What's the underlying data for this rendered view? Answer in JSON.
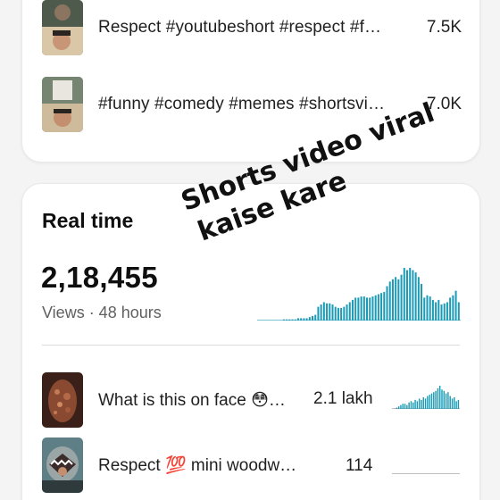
{
  "top_list": [
    {
      "title": "Respect #youtubeshort #respect #f…",
      "views": "7.5K"
    },
    {
      "title": "#funny #comedy #memes #shortsvi…",
      "views": "7.0K"
    }
  ],
  "realtime": {
    "title": "Real time",
    "count": "2,18,455",
    "subtitle": "Views · 48 hours"
  },
  "chart_data": {
    "type": "bar",
    "color": "#1a9ab5",
    "values": [
      0,
      0,
      0,
      0,
      0,
      0,
      0,
      0,
      0,
      1,
      1,
      1,
      1,
      1,
      2,
      2,
      2,
      2,
      3,
      4,
      5,
      12,
      14,
      16,
      15,
      15,
      14,
      12,
      11,
      11,
      12,
      14,
      16,
      18,
      20,
      20,
      21,
      21,
      20,
      20,
      21,
      22,
      23,
      24,
      25,
      30,
      34,
      36,
      38,
      36,
      40,
      46,
      44,
      46,
      44,
      42,
      38,
      32,
      20,
      22,
      21,
      18,
      16,
      18,
      14,
      15,
      16,
      20,
      22,
      26,
      16
    ]
  },
  "videos": [
    {
      "title": "What is this on face 😳…",
      "views": "2.1 lakh",
      "spark": [
        0,
        0,
        1,
        2,
        3,
        4,
        4,
        3,
        5,
        6,
        5,
        7,
        6,
        8,
        7,
        9,
        8,
        10,
        11,
        12,
        13,
        14,
        16,
        18,
        15,
        14,
        12,
        13,
        10,
        8,
        9,
        6,
        7
      ]
    },
    {
      "title": "Respect 💯 mini woodw…",
      "views": "114",
      "spark": []
    }
  ],
  "overlay_text": {
    "line1": "Shorts video viral",
    "line2": "kaise kare"
  }
}
